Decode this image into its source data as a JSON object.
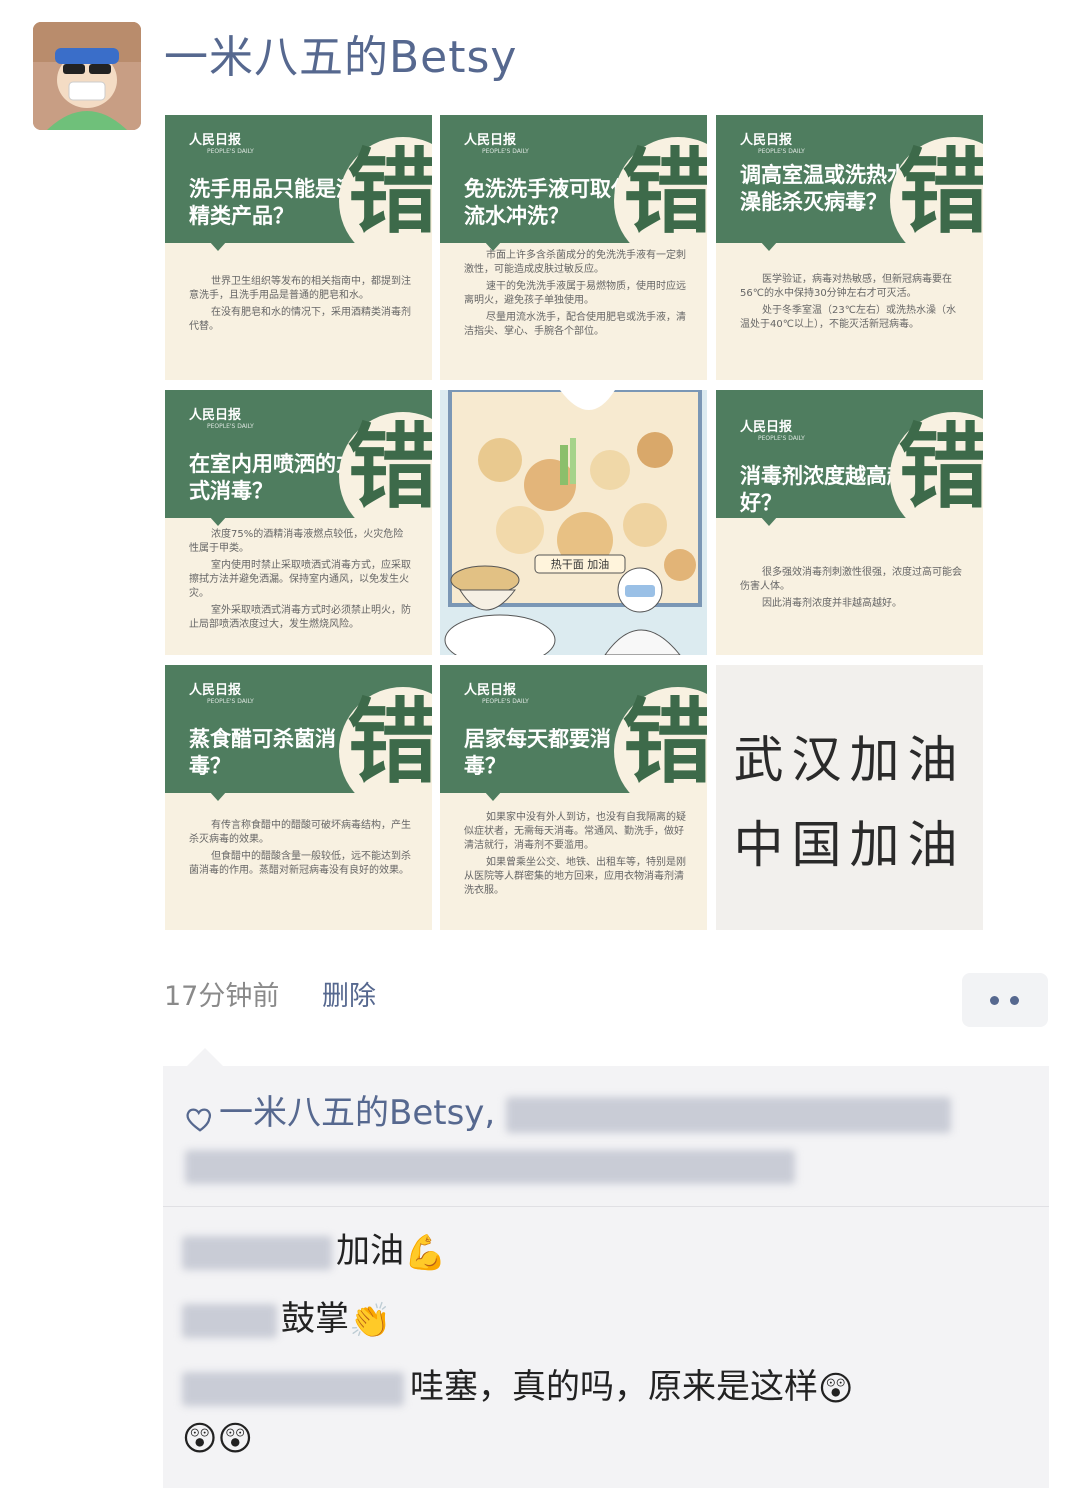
{
  "post": {
    "author": "一米八五的Betsy",
    "time": "17分钟前",
    "delete_label": "删除",
    "more_icon": "more-dots-icon"
  },
  "images": [
    {
      "logo": "人民日报",
      "logo_sub": "PEOPLE'S DAILY",
      "question": "洗手用品只能是酒精类产品？",
      "verdict": "错",
      "paragraphs": [
        "世界卫生组织等发布的相关指南中，都提到注意洗手，且洗手用品是普通的肥皂和水。",
        "在没有肥皂和水的情况下，采用酒精类消毒剂代替。"
      ]
    },
    {
      "logo": "人民日报",
      "logo_sub": "PEOPLE'S DAILY",
      "question": "免洗洗手液可取代流水冲洗？",
      "verdict": "错",
      "paragraphs": [
        "市面上许多含杀菌成分的免洗洗手液有一定刺激性，可能造成皮肤过敏反应。",
        "速干的免洗洗手液属于易燃物质，使用时应远离明火，避免孩子单独使用。",
        "尽量用流水洗手，配合使用肥皂或洗手液，清洁指尖、掌心、手腕各个部位。"
      ]
    },
    {
      "logo": "人民日报",
      "logo_sub": "PEOPLE'S DAILY",
      "question": "调高室温或洗热水澡能杀灭病毒？",
      "verdict": "错",
      "paragraphs": [
        "医学验证，病毒对热敏感，但新冠病毒要在56℃的水中保持30分钟左右才可灭活。",
        "处于冬季室温（23℃左右）或洗热水澡（水温处于40℃以上），不能灭活新冠病毒。"
      ]
    },
    {
      "logo": "人民日报",
      "logo_sub": "PEOPLE'S DAILY",
      "question": "在室内用喷洒的方式消毒？",
      "verdict": "错",
      "paragraphs": [
        "浓度75%的酒精消毒液燃点较低，火灾危险性属于甲类。",
        "室内使用时禁止采取喷洒式消毒方式，应采取擦拭方法并避免洒漏。保持室内通风，以免发生火灾。",
        "室外采取喷洒式消毒方式时必须禁止明火，防止局部喷洒浓度过大，发生燃烧风险。"
      ]
    },
    {
      "illustration_text": "热干面 加油"
    },
    {
      "logo": "人民日报",
      "logo_sub": "PEOPLE'S DAILY",
      "question": "消毒剂浓度越高越好？",
      "verdict": "错",
      "paragraphs": [
        "很多强效消毒剂刺激性很强，浓度过高可能会伤害人体。",
        "因此消毒剂浓度并非越高越好。"
      ]
    },
    {
      "logo": "人民日报",
      "logo_sub": "PEOPLE'S DAILY",
      "question": "蒸食醋可杀菌消毒？",
      "verdict": "错",
      "paragraphs": [
        "有传言称食醋中的醋酸可破坏病毒结构，产生杀灭病毒的效果。",
        "但食醋中的醋酸含量一般较低，远不能达到杀菌消毒的作用。蒸醋对新冠病毒没有良好的效果。"
      ]
    },
    {
      "logo": "人民日报",
      "logo_sub": "PEOPLE'S DAILY",
      "question": "居家每天都要消毒？",
      "verdict": "错",
      "paragraphs": [
        "如果家中没有外人到访，也没有自我隔离的疑似症状者，无需每天消毒。常通风、勤洗手，做好清洁就行，消毒剂不要滥用。",
        "如果曾乘坐公交、地铁、出租车等，特别是刚从医院等人群密集的地方回来，应用衣物消毒剂清洗衣服。"
      ]
    },
    {
      "handwriting_lines": [
        "武汉加油",
        "中国加油"
      ]
    }
  ],
  "likes": {
    "icon": "heart-outline-icon",
    "first_name": "一米八五的Betsy,"
  },
  "comments": [
    {
      "text": "加油",
      "emoji": "💪"
    },
    {
      "text": "鼓掌",
      "emoji": "👏"
    },
    {
      "text": "哇塞，真的吗，原来是这样",
      "emoji": "😲"
    }
  ],
  "trailing_emoji": [
    "😲",
    "😲"
  ]
}
